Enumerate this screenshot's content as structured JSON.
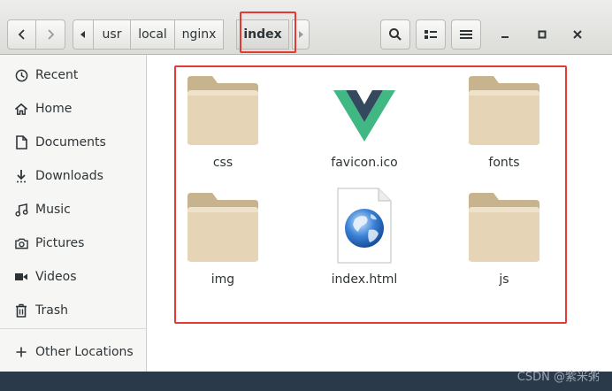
{
  "toolbar": {
    "back_icon": "chevron-left-icon",
    "forward_icon": "chevron-right-icon",
    "path": [
      "usr",
      "local",
      "nginx",
      "index"
    ],
    "search_icon": "search-icon",
    "view_icon": "list-view-icon",
    "menu_icon": "hamburger-menu-icon"
  },
  "sidebar": {
    "items": [
      {
        "label": "Recent",
        "icon": "clock-icon"
      },
      {
        "label": "Home",
        "icon": "home-icon"
      },
      {
        "label": "Documents",
        "icon": "document-icon"
      },
      {
        "label": "Downloads",
        "icon": "download-icon"
      },
      {
        "label": "Music",
        "icon": "music-icon"
      },
      {
        "label": "Pictures",
        "icon": "camera-icon"
      },
      {
        "label": "Videos",
        "icon": "video-icon"
      },
      {
        "label": "Trash",
        "icon": "trash-icon"
      }
    ],
    "other_locations": {
      "label": "Other Locations",
      "icon": "plus-icon"
    }
  },
  "files": [
    {
      "name": "css",
      "type": "folder"
    },
    {
      "name": "favicon.ico",
      "type": "vue-logo"
    },
    {
      "name": "fonts",
      "type": "folder"
    },
    {
      "name": "img",
      "type": "folder"
    },
    {
      "name": "index.html",
      "type": "html"
    },
    {
      "name": "js",
      "type": "folder"
    }
  ],
  "watermark": "CSDN @紫米粥",
  "colors": {
    "highlight": "#e53935",
    "folder": "#e6d4b6",
    "folder_tab": "#c7b48f",
    "vue_green": "#41b883",
    "vue_dark": "#35495e"
  }
}
